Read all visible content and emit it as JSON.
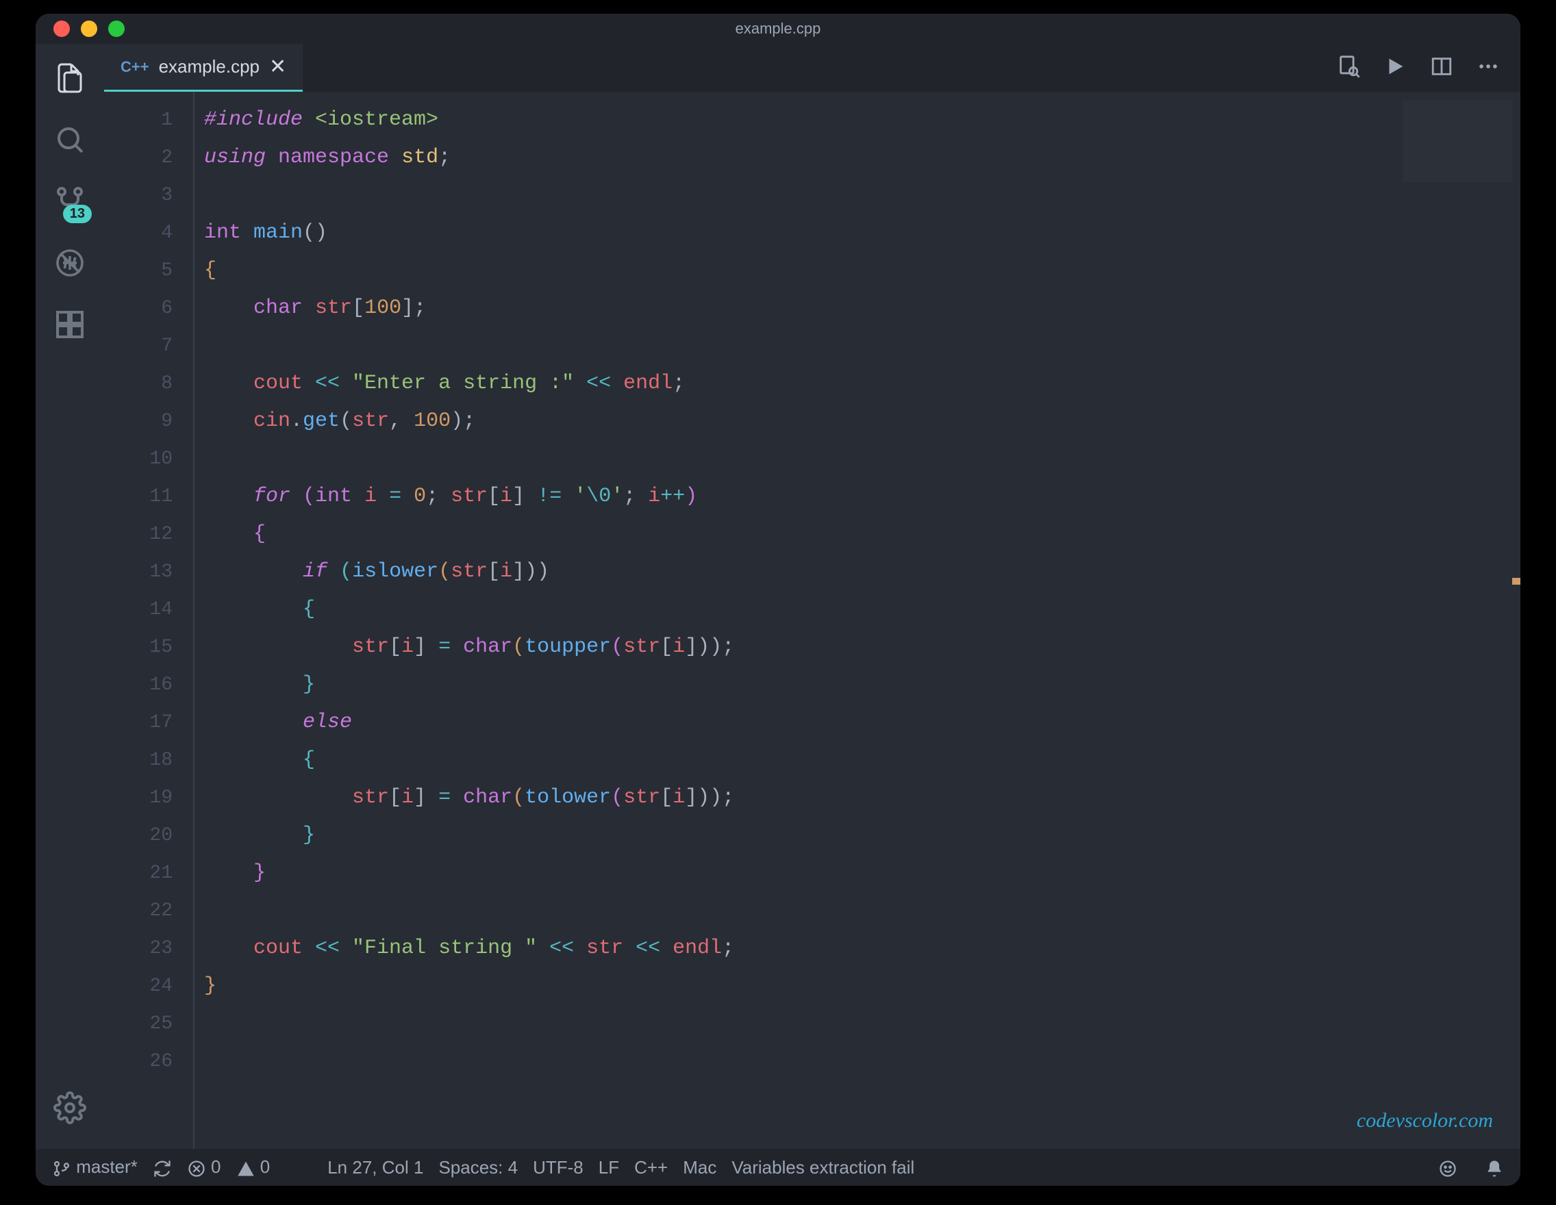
{
  "window": {
    "title": "example.cpp"
  },
  "tab": {
    "language_icon": "C++",
    "filename": "example.cpp"
  },
  "activity": {
    "scm_badge": "13"
  },
  "watermark": "codevscolor.com",
  "status": {
    "branch": "master*",
    "errors": "0",
    "warnings": "0",
    "cursor": "Ln 27, Col 1",
    "spaces": "Spaces: 4",
    "encoding": "UTF-8",
    "eol": "LF",
    "language": "C++",
    "os": "Mac",
    "extra": "Variables extraction fail"
  },
  "line_count": 26,
  "code": {
    "l1": {
      "a": "#include ",
      "b": "<iostream>"
    },
    "l2": {
      "a": "using ",
      "b": "namespace ",
      "c": "std",
      "d": ";"
    },
    "l4": {
      "a": "int ",
      "b": "main",
      "c": "()"
    },
    "l5": "{",
    "l6": {
      "a": "char ",
      "b": "str",
      "c": "[",
      "d": "100",
      "e": "];"
    },
    "l8": {
      "a": "cout ",
      "b": "<< ",
      "c": "\"Enter a string :\"",
      "d": " << ",
      "e": "endl",
      "f": ";"
    },
    "l9": {
      "a": "cin",
      "b": ".",
      "c": "get",
      "d": "(",
      "e": "str",
      "f": ", ",
      "g": "100",
      "h": ");"
    },
    "l11": {
      "a": "for ",
      "b": "(",
      "c": "int ",
      "d": "i ",
      "e": "= ",
      "f": "0",
      "g": "; ",
      "h": "str",
      "i": "[",
      "j": "i",
      "k": "] ",
      "l": "!= ",
      "m": "'",
      "n": "\\0",
      "o": "'",
      "p": "; ",
      "q": "i",
      "r": "++",
      "s": ")"
    },
    "l12": "{",
    "l13": {
      "a": "if ",
      "b": "(",
      "c": "islower",
      "d": "(",
      "e": "str",
      "f": "[",
      "g": "i",
      "h": "]))"
    },
    "l14": "{",
    "l15": {
      "a": "str",
      "b": "[",
      "c": "i",
      "d": "] ",
      "e": "= ",
      "f": "char",
      "g": "(",
      "h": "toupper",
      "i": "(",
      "j": "str",
      "k": "[",
      "l": "i",
      "m": "]));"
    },
    "l16": "}",
    "l17": "else",
    "l18": "{",
    "l19": {
      "a": "str",
      "b": "[",
      "c": "i",
      "d": "] ",
      "e": "= ",
      "f": "char",
      "g": "(",
      "h": "tolower",
      "i": "(",
      "j": "str",
      "k": "[",
      "l": "i",
      "m": "]));"
    },
    "l20": "}",
    "l21": "}",
    "l23": {
      "a": "cout ",
      "b": "<< ",
      "c": "\"Final string \"",
      "d": " << ",
      "e": "str ",
      "f": "<< ",
      "g": "endl",
      "h": ";"
    },
    "l24": "}"
  }
}
